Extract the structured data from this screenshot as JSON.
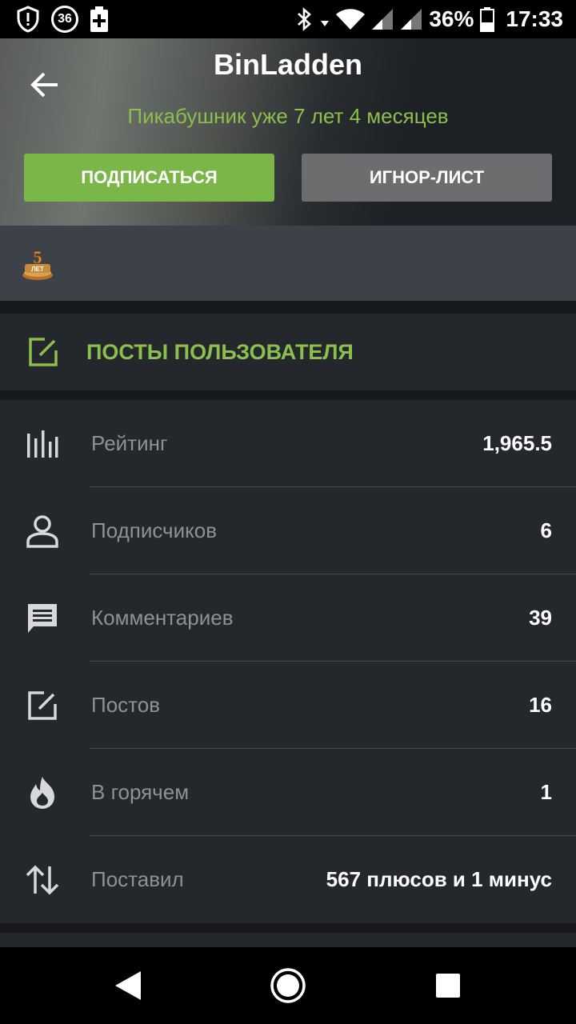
{
  "status_bar": {
    "notification_badge": "36",
    "battery_percent": "36%",
    "time": "17:33",
    "icons": [
      "shield-alert-icon",
      "badge-36-icon",
      "battery-plus-icon",
      "bluetooth-icon",
      "data-arrow-icon",
      "wifi-icon",
      "signal-icon",
      "signal-icon",
      "battery-icon"
    ]
  },
  "profile": {
    "username": "BinLadden",
    "tenure": "Пикабушник уже 7 лет 4 месяцев",
    "subscribe_label": "ПОДПИСАТЬСЯ",
    "ignore_label": "ИГНОР-ЛИСТ"
  },
  "awards": {
    "items": [
      {
        "icon": "five-years-award-icon",
        "text": "5 ЛЕТ"
      }
    ]
  },
  "posts_link": {
    "label": "ПОСТЫ ПОЛЬЗОВАТЕЛЯ",
    "icon": "edit-icon"
  },
  "stats": [
    {
      "icon": "bar-chart-icon",
      "label": "Рейтинг",
      "value": "1,965.5"
    },
    {
      "icon": "person-icon",
      "label": "Подписчиков",
      "value": "6"
    },
    {
      "icon": "comment-icon",
      "label": "Комментариев",
      "value": "39"
    },
    {
      "icon": "edit-icon",
      "label": "Постов",
      "value": "16"
    },
    {
      "icon": "flame-icon",
      "label": "В горячем",
      "value": "1"
    },
    {
      "icon": "swap-vertical-icon",
      "label": "Поставил",
      "value": "567 плюсов и 1 минус"
    }
  ],
  "colors": {
    "accent_green": "#8bbf4e",
    "subscribe_bg": "#7ab648",
    "ignore_bg": "#6b6d6f",
    "panel_bg": "#24272b"
  },
  "navbar": {
    "icons": [
      "back-triangle-icon",
      "home-circle-icon",
      "recents-square-icon"
    ]
  }
}
